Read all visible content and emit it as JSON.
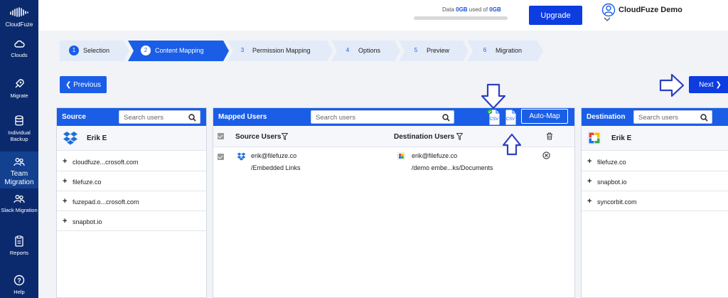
{
  "brand": {
    "name": "CloudFuze"
  },
  "sidebar": {
    "items": [
      {
        "label": "Clouds",
        "icon": "cloud-icon"
      },
      {
        "label": "Migrate",
        "icon": "rocket-icon"
      },
      {
        "label": "Individual Backup",
        "icon": "database-icon"
      },
      {
        "label": "Team Migration",
        "icon": "team-icon"
      },
      {
        "label": "Slack Migration",
        "icon": "team-icon"
      },
      {
        "label": "Reports",
        "icon": "report-icon"
      },
      {
        "label": "Help",
        "icon": "help-icon"
      }
    ]
  },
  "header": {
    "data_prefix": "Data ",
    "data_used": "0GB",
    "data_mid": " used of ",
    "data_total": "0GB",
    "upgrade_label": "Upgrade",
    "user_name": "CloudFuze Demo"
  },
  "steps": [
    {
      "num": "1",
      "label": "Selection"
    },
    {
      "num": "2",
      "label": "Content Mapping"
    },
    {
      "num": "3",
      "label": "Permission Mapping"
    },
    {
      "num": "4",
      "label": "Options"
    },
    {
      "num": "5",
      "label": "Preview"
    },
    {
      "num": "6",
      "label": "Migration"
    }
  ],
  "nav": {
    "previous": "Previous",
    "next": "Next"
  },
  "source": {
    "title": "Source",
    "search_placeholder": "Search users",
    "owner": "Erik E",
    "items": [
      "cloudfuze...crosoft.com",
      "filefuze.co",
      "fuzepad.o...crosoft.com",
      "snapbot.io"
    ]
  },
  "mapped": {
    "title": "Mapped Users",
    "search_placeholder": "Search users",
    "automap_label": "Auto-Map",
    "csv_label": "CSV",
    "col_source": "Source Users",
    "col_destination": "Destination Users",
    "rows": [
      {
        "source_email": "erik@filefuze.co",
        "source_path": "/Embedded Links",
        "dest_email": "erik@filefuze.co",
        "dest_path": "/demo embe...ks/Documents"
      }
    ]
  },
  "destination": {
    "title": "Destination",
    "search_placeholder": "Search users",
    "owner": "Erik E",
    "items": [
      "filefuze.co",
      "snapbot.io",
      "syncorbit.com"
    ]
  },
  "colors": {
    "sidebar": "#0b2a6e",
    "primary": "#1a5ee8",
    "accent": "#0d3ce0",
    "step_idle": "#e4ebf8"
  }
}
